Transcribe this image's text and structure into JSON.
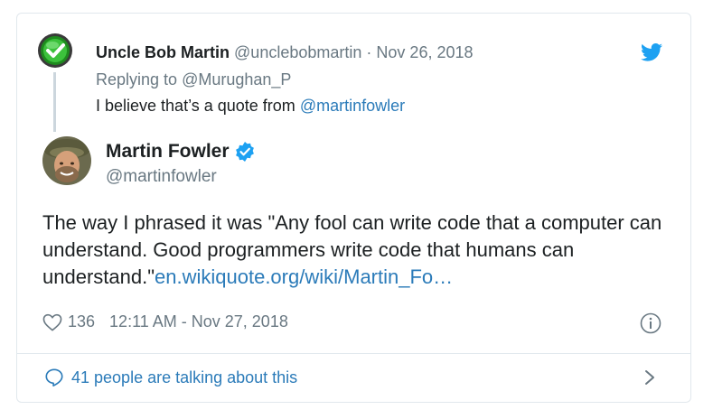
{
  "parent": {
    "name": "Uncle Bob Martin",
    "handle": "@unclebobmartin",
    "separator": "·",
    "date": "Nov 26, 2018",
    "reply_prefix": "Replying to ",
    "reply_to": "@Murughan_P",
    "text": "I believe that’s a quote from ",
    "mention": "@martinfowler",
    "avatar_icon": "green-checkmark-badge-icon"
  },
  "main": {
    "name": "Martin Fowler",
    "handle": "@martinfowler",
    "text": "The way I phrased it was \"Any fool can write code that a computer can understand. Good programmers write code that humans can understand.\"",
    "link": "en.wikiquote.org/wiki/Martin_Fo…",
    "likes": "136",
    "timestamp": "12:11 AM - Nov 27, 2018"
  },
  "footer": {
    "talking": "41 people are talking about this"
  },
  "colors": {
    "link": "#2b7bb9",
    "muted": "#697882",
    "text": "#1c2022",
    "verified": "#1da1f2",
    "border": "#e1e8ed"
  }
}
